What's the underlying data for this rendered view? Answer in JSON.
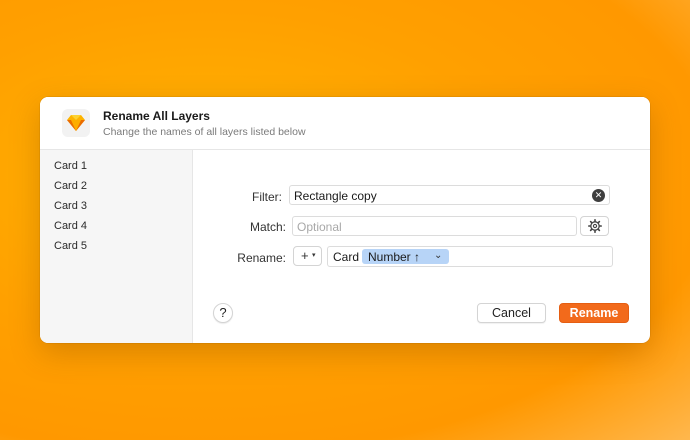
{
  "header": {
    "title": "Rename All Layers",
    "subtitle": "Change the names of all layers listed below",
    "app_icon": "sketch-diamond-icon"
  },
  "sidebar": {
    "items": [
      "Card 1",
      "Card 2",
      "Card 3",
      "Card 4",
      "Card 5"
    ]
  },
  "form": {
    "filter_label": "Filter:",
    "filter_value": "Rectangle copy",
    "match_label": "Match:",
    "match_placeholder": "Optional",
    "rename_label": "Rename:",
    "add_token_symbol": "+",
    "tokens": {
      "text": "Card",
      "number_label": "Number",
      "number_arrow": "↑",
      "chevron": "⌄"
    }
  },
  "footer": {
    "help_label": "?",
    "cancel_label": "Cancel",
    "rename_label": "Rename"
  },
  "colors": {
    "accent": "#f26a1b",
    "token_bg": "#b7d4f7",
    "background": "#ffa000"
  }
}
